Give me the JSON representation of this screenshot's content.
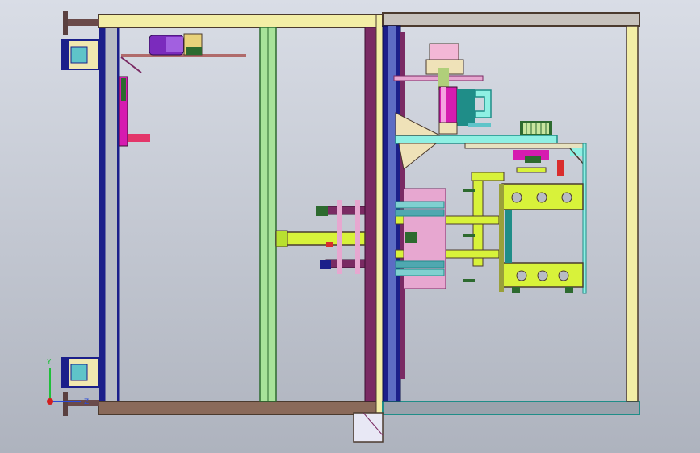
{
  "viewport": {
    "background_top": "#d9dde6",
    "background_bottom": "#aeb3be"
  },
  "colors": {
    "frame_yellow": "#f3eea6",
    "frame_dark": "#4b3a2e",
    "frame_blue": "#1b1f8a",
    "frame_purple": "#7a2a63",
    "frame_green": "#8fcf85",
    "frame_gray": "#b8bcc4",
    "lime": "#d8f23a",
    "pink": "#e7a7d0",
    "magenta": "#d61bb0",
    "violet": "#7b2bbd",
    "cyan": "#8ff0e3",
    "teal": "#1f8d88",
    "tan": "#efe2b8",
    "olive": "#9aa03a",
    "green_dark": "#2d6a2f",
    "red": "#d92d2d"
  },
  "triad": {
    "labels": {
      "y": "Y",
      "z": "Z"
    },
    "colors": {
      "y": "#1fbf3a",
      "z": "#2a4bd9",
      "x": "#d21f1f"
    }
  }
}
